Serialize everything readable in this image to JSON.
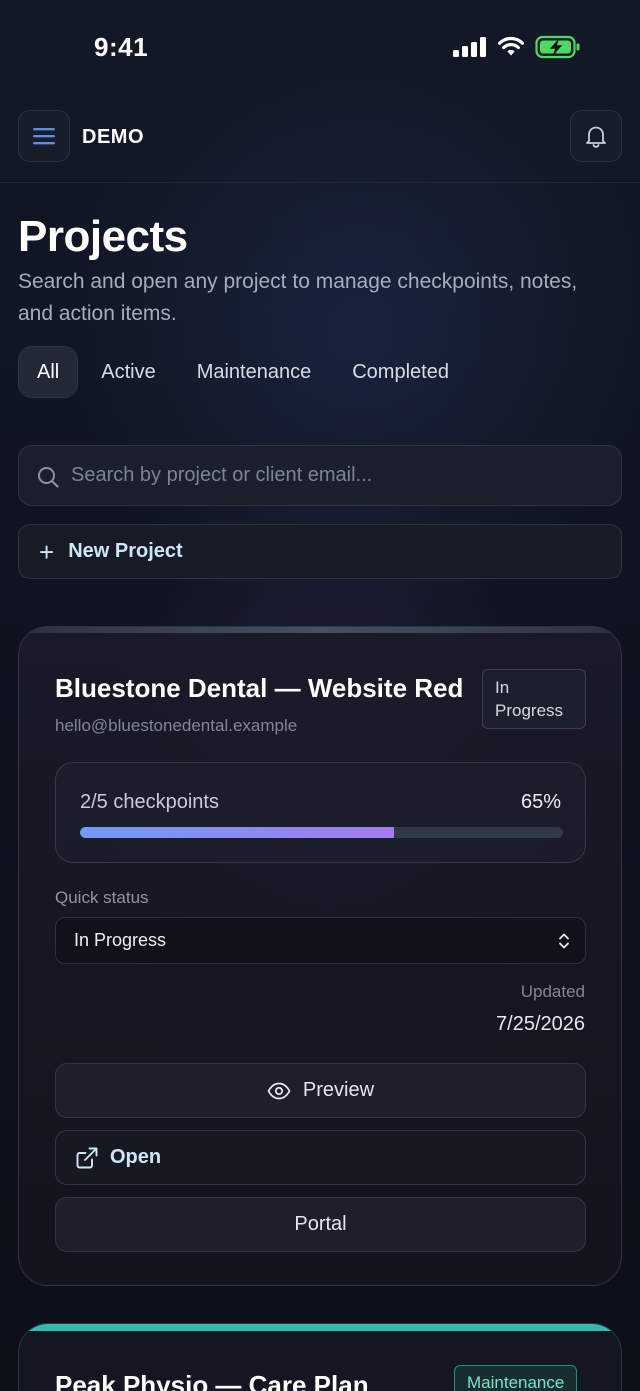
{
  "status_bar": {
    "time": "9:41"
  },
  "header": {
    "brand": "DEMO"
  },
  "page": {
    "title": "Projects",
    "subtitle": "Search and open any project to manage checkpoints, notes, and action items."
  },
  "filters": {
    "tabs": [
      {
        "label": "All",
        "active": true
      },
      {
        "label": "Active",
        "active": false
      },
      {
        "label": "Maintenance",
        "active": false
      },
      {
        "label": "Completed",
        "active": false
      }
    ]
  },
  "search": {
    "placeholder": "Search by project or client email...",
    "value": ""
  },
  "new_project": {
    "label": "New Project"
  },
  "projects": [
    {
      "title": "Bluestone Dental — Website Redesign",
      "email": "hello@bluestonedental.example",
      "status": "In Progress",
      "checkpoints_label": "2/5 checkpoints",
      "progress_percent_label": "65%",
      "progress_fraction": 0.65,
      "quick_status_label": "Quick status",
      "quick_status_value": "In Progress",
      "updated_label": "Updated",
      "updated_date": "7/25/2026",
      "preview_label": "Preview",
      "open_label": "Open",
      "portal_label": "Portal"
    },
    {
      "title": "Peak Physio — Care Plan",
      "status": "Maintenance"
    }
  ],
  "colors": {
    "background": "#0d1119",
    "accent_link": "#cfe6f5",
    "progress_start": "#6f9cf5",
    "progress_end": "#a47cf0",
    "maintenance_teal": "#2fbfa9",
    "battery_green": "#4cd964"
  },
  "icons": {
    "menu": "hamburger-menu-icon",
    "notifications": "bell-icon",
    "search": "search-icon",
    "add": "plus-icon",
    "preview": "eye-icon",
    "open": "external-link-icon",
    "select": "chevron-up-down-icon"
  }
}
